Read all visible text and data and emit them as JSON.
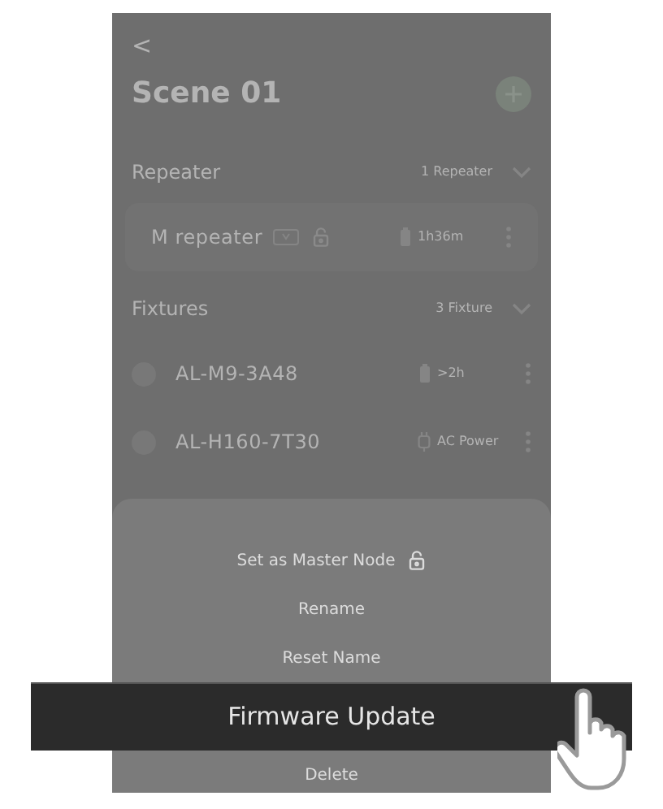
{
  "header": {
    "back": "<",
    "title": "Scene 01"
  },
  "sections": [
    {
      "title": "Repeater",
      "count": "1 Repeater",
      "expanded": true,
      "rows": [
        {
          "kind": "repeater",
          "name": "M repeater",
          "locked": true,
          "on_battery": true,
          "status": "1h36m"
        }
      ]
    },
    {
      "title": "Fixtures",
      "count": "3 Fixture",
      "expanded": true,
      "rows": [
        {
          "kind": "fixture",
          "name": "AL-M9-3A48",
          "locked": false,
          "on_battery": true,
          "status": ">2h"
        },
        {
          "kind": "fixture",
          "name": "AL-H160-7T30",
          "locked": false,
          "on_battery": false,
          "status": "AC Power"
        }
      ]
    }
  ],
  "sheet": {
    "items": [
      {
        "label": "Set as Master Node",
        "locked": true,
        "selected": false
      },
      {
        "label": "Rename",
        "locked": false,
        "selected": false
      },
      {
        "label": "Reset Name",
        "locked": false,
        "selected": false
      },
      {
        "label": "Firmware Update",
        "locked": false,
        "selected": true
      },
      {
        "label": "Delete",
        "locked": false,
        "selected": false
      }
    ]
  }
}
